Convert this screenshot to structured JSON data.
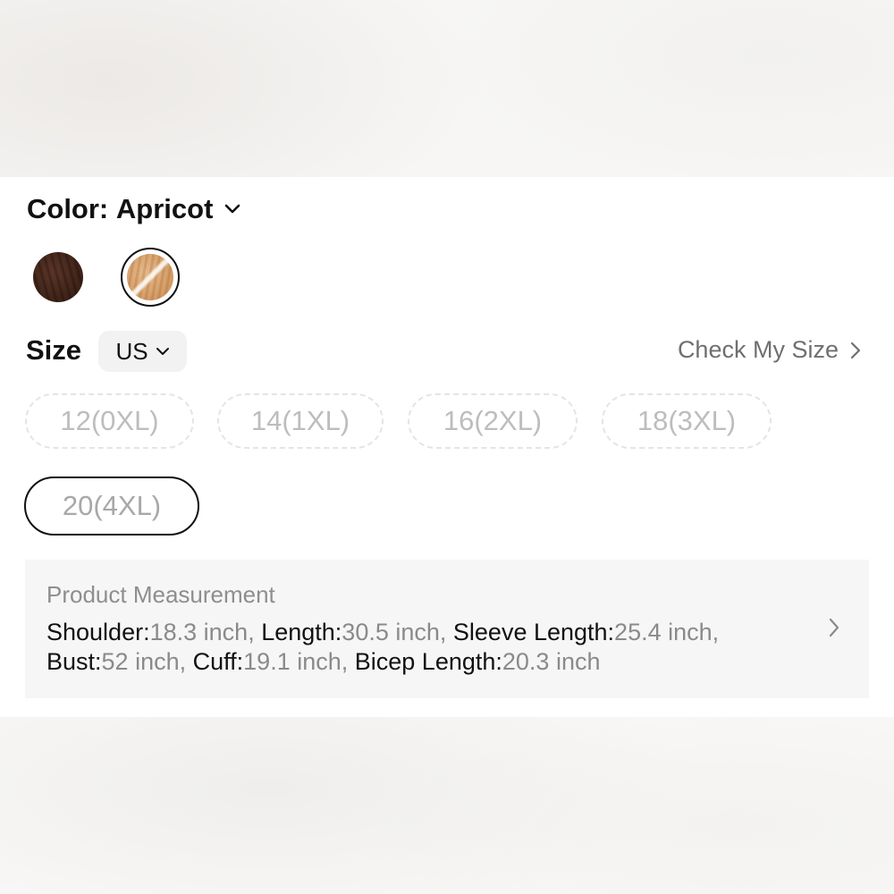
{
  "color": {
    "label": "Color:",
    "value": "Apricot",
    "swatches": [
      {
        "name": "Brown",
        "hex": "#3d2217",
        "selected": false
      },
      {
        "name": "Apricot",
        "hex": "#d39a63",
        "selected": true
      }
    ]
  },
  "size": {
    "label": "Size",
    "unit": "US",
    "check_link": "Check My Size",
    "options": [
      {
        "label": "12(0XL)",
        "available": false,
        "selected": false
      },
      {
        "label": "14(1XL)",
        "available": false,
        "selected": false
      },
      {
        "label": "16(2XL)",
        "available": false,
        "selected": false
      },
      {
        "label": "18(3XL)",
        "available": false,
        "selected": false
      },
      {
        "label": "20(4XL)",
        "available": false,
        "selected": true
      }
    ]
  },
  "measurement": {
    "title": "Product Measurement",
    "items": [
      {
        "key": "Shoulder:",
        "value": "18.3 inch"
      },
      {
        "key": "Length:",
        "value": "30.5 inch"
      },
      {
        "key": "Sleeve Length:",
        "value": "25.4 inch"
      },
      {
        "key": "Bust:",
        "value": "52 inch"
      },
      {
        "key": "Cuff:",
        "value": "19.1 inch"
      },
      {
        "key": "Bicep Length:",
        "value": "20.3 inch"
      }
    ],
    "separator": ", "
  },
  "icons": [
    "chevron-down-icon",
    "chevron-right-icon"
  ],
  "colors": {
    "text": "#111111",
    "muted": "#8a8a8a",
    "chip_border": "#e4e4e4",
    "panel_bg": "#f6f6f6"
  }
}
